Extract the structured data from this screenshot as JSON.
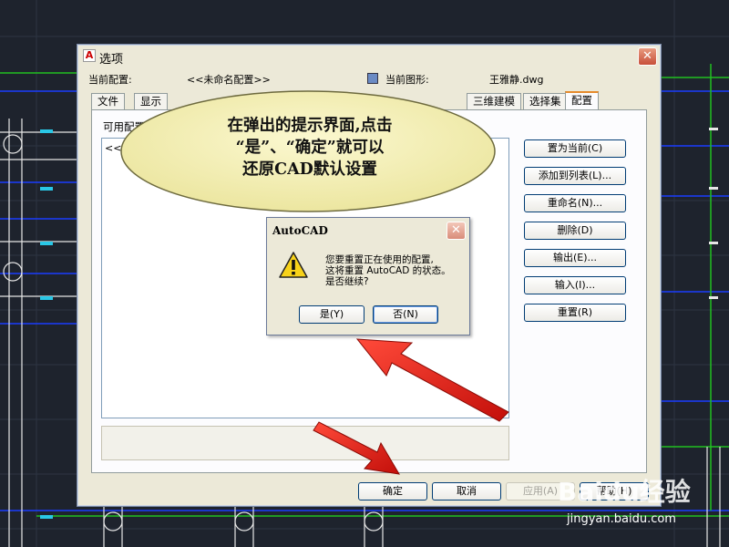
{
  "dialog": {
    "title": "选项",
    "close_label": "✕",
    "current_profile_label": "当前配置:",
    "current_profile_value": "<<未命名配置>>",
    "current_drawing_label": "当前图形:",
    "current_drawing_value": "王雅静.dwg",
    "tabs": [
      {
        "label": "文件",
        "active": false
      },
      {
        "label": "显示",
        "active": false
      },
      {
        "label": "三维建模",
        "active": false
      },
      {
        "label": "选择集",
        "active": false
      },
      {
        "label": "配置",
        "active": true
      }
    ],
    "available_profiles_label": "可用配置",
    "profiles": [
      "<<未命"
    ],
    "side_buttons": [
      {
        "name": "set-current-button",
        "label": "置为当前(C)"
      },
      {
        "name": "add-to-list-button",
        "label": "添加到列表(L)..."
      },
      {
        "name": "rename-button",
        "label": "重命名(N)..."
      },
      {
        "name": "delete-button",
        "label": "删除(D)"
      },
      {
        "name": "export-button",
        "label": "输出(E)..."
      },
      {
        "name": "import-button",
        "label": "输入(I)..."
      },
      {
        "name": "reset-button",
        "label": "重置(R)"
      }
    ],
    "bottom_buttons": [
      {
        "name": "ok-button",
        "label": "确定",
        "enabled": true
      },
      {
        "name": "cancel-button",
        "label": "取消",
        "enabled": true
      },
      {
        "name": "apply-button",
        "label": "应用(A)",
        "enabled": false
      },
      {
        "name": "help-button",
        "label": "帮助(H)",
        "enabled": true
      }
    ]
  },
  "popup": {
    "title": "AutoCAD",
    "close_label": "✕",
    "message_lines": [
      "您要重置正在使用的配置,",
      "这将重置 AutoCAD 的状态。",
      "是否继续?"
    ],
    "yes_label": "是(Y)",
    "no_label": "否(N)"
  },
  "callout": {
    "lines": [
      "在弹出的提示界面,点击",
      "“是”、“确定”就可以",
      "还原CAD默认设置"
    ]
  },
  "watermark": {
    "logo": "Baidu经验",
    "url": "jingyan.baidu.com"
  },
  "colors": {
    "callout_fill": "#f6f3b4",
    "arrow_red": "#e81c14",
    "cad_background": "#1e232d"
  },
  "icons": {
    "app": "autocad-logo-icon",
    "warning": "warning-triangle-icon"
  }
}
